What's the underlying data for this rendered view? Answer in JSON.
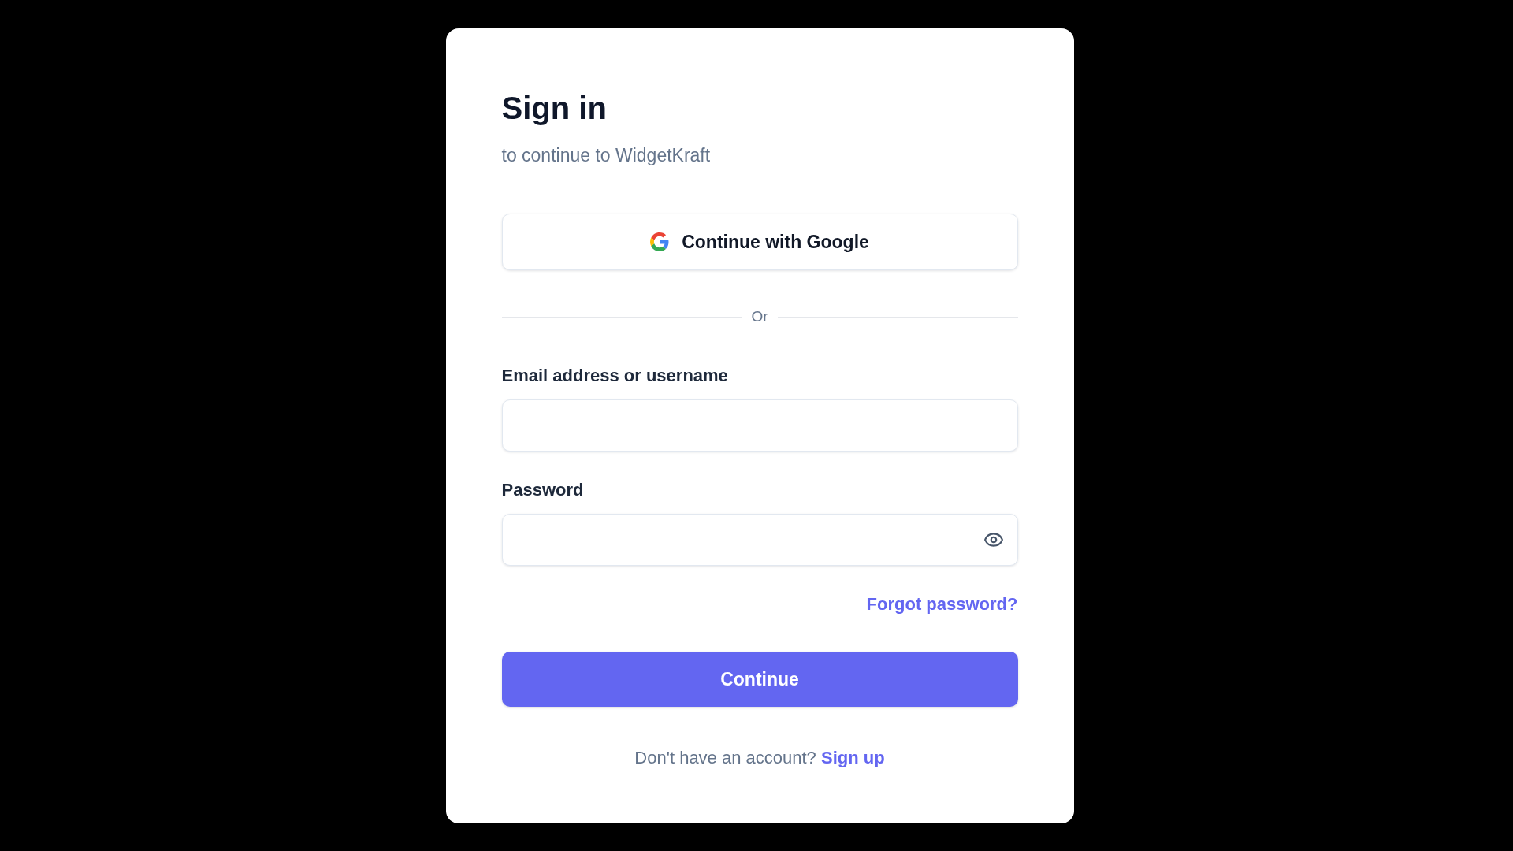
{
  "heading": {
    "title": "Sign in",
    "subtitle": "to continue to WidgetKraft"
  },
  "social_button": {
    "label": "Continue with Google"
  },
  "divider": {
    "label": "Or"
  },
  "fields": [
    {
      "label": "Email address or username",
      "kind": "text"
    },
    {
      "label": "Password",
      "kind": "password"
    }
  ],
  "forgot_link": "Forgot password?",
  "submit_button": "Continue",
  "footer": {
    "text": "Don't have an account?",
    "link": "Sign up"
  }
}
